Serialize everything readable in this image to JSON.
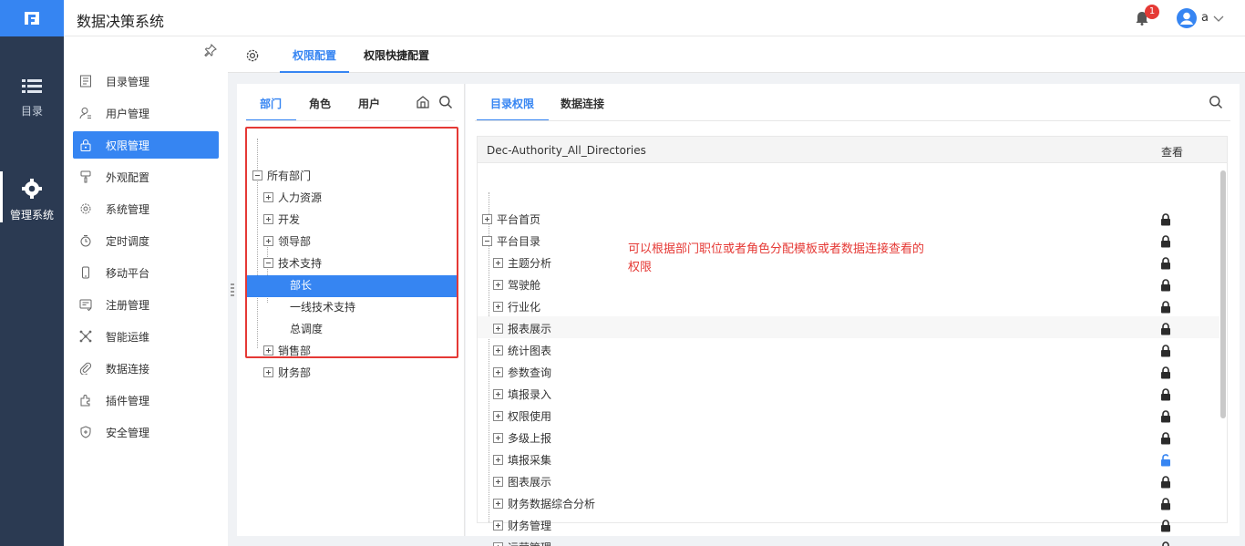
{
  "app": {
    "title": "数据决策系统",
    "logo_icon": "fine-logo-icon"
  },
  "header": {
    "notification_count": "1",
    "user": "a"
  },
  "rail": {
    "items": [
      {
        "label": "目录",
        "icon": "list-icon",
        "active": false
      },
      {
        "label": "管理系统",
        "icon": "gear-icon",
        "active": true
      }
    ]
  },
  "sidebar": {
    "items": [
      {
        "label": "目录管理",
        "icon": "catalog-icon"
      },
      {
        "label": "用户管理",
        "icon": "user-icon"
      },
      {
        "label": "权限管理",
        "icon": "lock-icon",
        "active": true
      },
      {
        "label": "外观配置",
        "icon": "brush-icon"
      },
      {
        "label": "系统管理",
        "icon": "gear-icon"
      },
      {
        "label": "定时调度",
        "icon": "timer-icon"
      },
      {
        "label": "移动平台",
        "icon": "mobile-icon"
      },
      {
        "label": "注册管理",
        "icon": "register-icon"
      },
      {
        "label": "智能运维",
        "icon": "ops-icon"
      },
      {
        "label": "数据连接",
        "icon": "link-icon"
      },
      {
        "label": "插件管理",
        "icon": "plugin-icon"
      },
      {
        "label": "安全管理",
        "icon": "shield-icon"
      }
    ]
  },
  "top_tabs": [
    {
      "label": "权限配置",
      "active": true
    },
    {
      "label": "权限快捷配置",
      "active": false
    }
  ],
  "left_panel": {
    "tabs": [
      {
        "label": "部门",
        "active": true
      },
      {
        "label": "角色",
        "active": false
      },
      {
        "label": "用户",
        "active": false
      }
    ],
    "tree": [
      {
        "label": "所有部门",
        "level": 0,
        "toggle": "minus"
      },
      {
        "label": "人力资源",
        "level": 1,
        "toggle": "plus"
      },
      {
        "label": "开发",
        "level": 1,
        "toggle": "plus"
      },
      {
        "label": "领导部",
        "level": 1,
        "toggle": "plus"
      },
      {
        "label": "技术支持",
        "level": 1,
        "toggle": "minus"
      },
      {
        "label": "部长",
        "level": 2,
        "toggle": "none",
        "selected": true
      },
      {
        "label": "一线技术支持",
        "level": 2,
        "toggle": "none"
      },
      {
        "label": "总调度",
        "level": 2,
        "toggle": "none"
      },
      {
        "label": "销售部",
        "level": 1,
        "toggle": "plus"
      },
      {
        "label": "财务部",
        "level": 1,
        "toggle": "plus"
      }
    ]
  },
  "right_panel": {
    "tabs": [
      {
        "label": "目录权限",
        "active": true
      },
      {
        "label": "数据连接",
        "active": false
      }
    ],
    "table": {
      "col_name": "Dec-Authority_All_Directories",
      "col_view": "查看",
      "rows": [
        {
          "label": "平台首页",
          "level": 0,
          "toggle": "plus",
          "lock": "locked"
        },
        {
          "label": "平台目录",
          "level": 0,
          "toggle": "minus",
          "lock": "locked"
        },
        {
          "label": "主题分析",
          "level": 1,
          "toggle": "plus",
          "lock": "locked"
        },
        {
          "label": "驾驶舱",
          "level": 1,
          "toggle": "plus",
          "lock": "locked"
        },
        {
          "label": "行业化",
          "level": 1,
          "toggle": "plus",
          "lock": "locked"
        },
        {
          "label": "报表展示",
          "level": 1,
          "toggle": "plus",
          "lock": "locked"
        },
        {
          "label": "统计图表",
          "level": 1,
          "toggle": "plus",
          "lock": "locked"
        },
        {
          "label": "参数查询",
          "level": 1,
          "toggle": "plus",
          "lock": "locked",
          "highlight": true
        },
        {
          "label": "填报录入",
          "level": 1,
          "toggle": "plus",
          "lock": "locked"
        },
        {
          "label": "权限使用",
          "level": 1,
          "toggle": "plus",
          "lock": "locked"
        },
        {
          "label": "多级上报",
          "level": 1,
          "toggle": "plus",
          "lock": "locked"
        },
        {
          "label": "填报采集",
          "level": 1,
          "toggle": "plus",
          "lock": "unlocked"
        },
        {
          "label": "图表展示",
          "level": 1,
          "toggle": "plus",
          "lock": "locked"
        },
        {
          "label": "财务数据综合分析",
          "level": 1,
          "toggle": "plus",
          "lock": "locked"
        },
        {
          "label": "财务管理",
          "level": 1,
          "toggle": "plus",
          "lock": "locked"
        },
        {
          "label": "运营管理",
          "level": 1,
          "toggle": "plus",
          "lock": "locked"
        }
      ]
    }
  },
  "annotation": "可以根据部门职位或者角色分配模板或者数据连接查看的权限",
  "colors": {
    "brand": "#3685f2",
    "rail": "#2b3a52",
    "annotation": "#e53935",
    "unlocked": "#3685f2"
  }
}
